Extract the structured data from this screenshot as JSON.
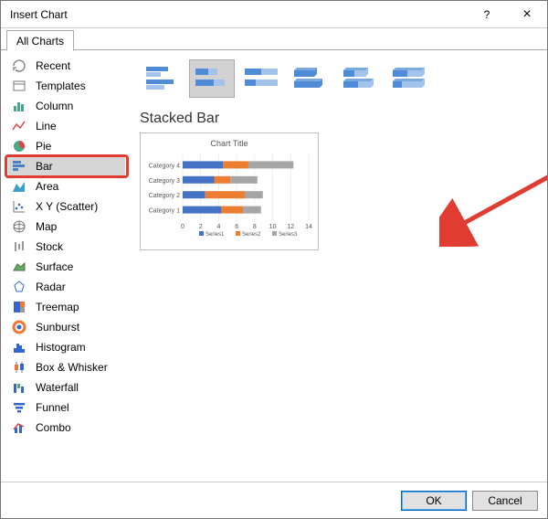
{
  "window": {
    "title": "Insert Chart",
    "help_icon": "?",
    "close_icon": "×"
  },
  "tabs": [
    {
      "label": "All Charts",
      "active": true
    }
  ],
  "sidebar": {
    "items": [
      {
        "label": "Recent",
        "icon": "recent"
      },
      {
        "label": "Templates",
        "icon": "templates"
      },
      {
        "label": "Column",
        "icon": "column"
      },
      {
        "label": "Line",
        "icon": "line"
      },
      {
        "label": "Pie",
        "icon": "pie"
      },
      {
        "label": "Bar",
        "icon": "bar",
        "selected": true
      },
      {
        "label": "Area",
        "icon": "area"
      },
      {
        "label": "X Y (Scatter)",
        "icon": "scatter"
      },
      {
        "label": "Map",
        "icon": "map"
      },
      {
        "label": "Stock",
        "icon": "stock"
      },
      {
        "label": "Surface",
        "icon": "surface"
      },
      {
        "label": "Radar",
        "icon": "radar"
      },
      {
        "label": "Treemap",
        "icon": "treemap"
      },
      {
        "label": "Sunburst",
        "icon": "sunburst"
      },
      {
        "label": "Histogram",
        "icon": "histogram"
      },
      {
        "label": "Box & Whisker",
        "icon": "boxwhisker"
      },
      {
        "label": "Waterfall",
        "icon": "waterfall"
      },
      {
        "label": "Funnel",
        "icon": "funnel"
      },
      {
        "label": "Combo",
        "icon": "combo"
      }
    ]
  },
  "subtypes": [
    {
      "name": "clustered-bar",
      "selected": false
    },
    {
      "name": "stacked-bar",
      "selected": true
    },
    {
      "name": "100-stacked-bar",
      "selected": false
    },
    {
      "name": "3d-clustered-bar",
      "selected": false
    },
    {
      "name": "3d-stacked-bar",
      "selected": false
    },
    {
      "name": "3d-100-stacked-bar",
      "selected": false
    }
  ],
  "section_title": "Stacked Bar",
  "preview": {
    "title": "Chart Title",
    "legend": [
      "Series1",
      "Series2",
      "Series3"
    ]
  },
  "chart_data": {
    "type": "bar",
    "orientation": "horizontal",
    "stacked": true,
    "title": "Chart Title",
    "xlabel": "",
    "ylabel": "",
    "xlim": [
      0,
      14
    ],
    "xticks": [
      0,
      2,
      4,
      6,
      8,
      10,
      12,
      14
    ],
    "categories": [
      "Category 1",
      "Category 2",
      "Category 3",
      "Category 4"
    ],
    "series": [
      {
        "name": "Series1",
        "color": "#4472C4",
        "values": [
          4.3,
          2.5,
          3.5,
          4.5
        ]
      },
      {
        "name": "Series2",
        "color": "#ED7D31",
        "values": [
          2.4,
          4.4,
          1.8,
          2.8
        ]
      },
      {
        "name": "Series3",
        "color": "#A5A5A5",
        "values": [
          2.0,
          2.0,
          3.0,
          5.0
        ]
      }
    ]
  },
  "buttons": {
    "ok": "OK",
    "cancel": "Cancel"
  },
  "annotation": "arrow"
}
